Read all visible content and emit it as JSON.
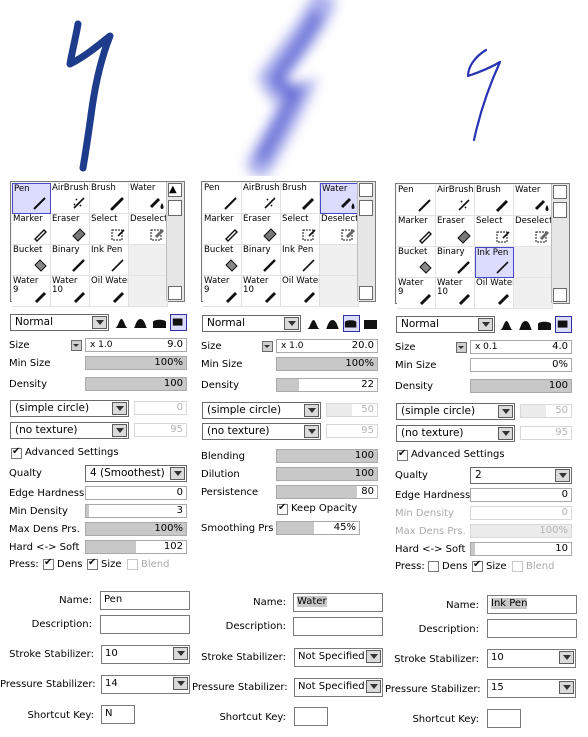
{
  "columns": [
    {
      "tools": [
        "Pen",
        "AirBrush",
        "Brush",
        "Water",
        "Marker",
        "Eraser",
        "Select",
        "Deselect",
        "Bucket",
        "Binary",
        "Ink Pen",
        "",
        "Water 9",
        "Water 10",
        "Oil Water",
        ""
      ],
      "selected_tool": 0,
      "blend_mode": "Normal",
      "selected_shape": 3,
      "size_prefix": "x 1.0",
      "size": "9.0",
      "min_size": "100%",
      "density": "100",
      "shape": "(simple circle)",
      "shape_value": "0",
      "texture": "(no texture)",
      "texture_value": "95",
      "advanced_label": "Advanced Settings",
      "rows": [
        {
          "label": "Qualty",
          "type": "select",
          "value": "4 (Smoothest)"
        },
        {
          "label": "Edge Hardness",
          "type": "bar",
          "value": "0",
          "fill": 0
        },
        {
          "label": "Min Density",
          "type": "bar",
          "value": "3",
          "fill": 3
        },
        {
          "label": "Max Dens Prs.",
          "type": "bar",
          "value": "100%",
          "fill": 100
        },
        {
          "label": "Hard <-> Soft",
          "type": "bar",
          "value": "102",
          "fill": 50
        }
      ],
      "press": {
        "label": "Press:",
        "dens": "Dens",
        "size": "Size",
        "blend": "Blend"
      },
      "form": {
        "name": "Pen",
        "description": "",
        "stroke_stabilizer": "10",
        "pressure_stabilizer": "14",
        "shortcut": "N"
      }
    },
    {
      "tools": [
        "Pen",
        "AirBrush",
        "Brush",
        "Water",
        "Marker",
        "Eraser",
        "Select",
        "Deselect",
        "Bucket",
        "Binary",
        "Ink Pen",
        "",
        "Water 9",
        "Water 10",
        "Oil Water",
        ""
      ],
      "selected_tool": 3,
      "blend_mode": "Normal",
      "selected_shape": 2,
      "size_prefix": "x 1.0",
      "size": "20.0",
      "min_size": "100%",
      "density": "22",
      "shape": "(simple circle)",
      "shape_value": "50",
      "texture": "(no texture)",
      "texture_value": "95",
      "rows": [
        {
          "label": "Blending",
          "type": "bar",
          "value": "100",
          "fill": 100
        },
        {
          "label": "Dilution",
          "type": "bar",
          "value": "100",
          "fill": 100
        },
        {
          "label": "Persistence",
          "type": "bar",
          "value": "80",
          "fill": 80
        },
        {
          "label": "",
          "type": "check",
          "value": "Keep Opacity"
        },
        {
          "label": "Smoothing Prs",
          "type": "bar",
          "value": "45%",
          "fill": 45
        }
      ],
      "form": {
        "name": "Water",
        "description": "",
        "stroke_stabilizer": "Not Specified",
        "pressure_stabilizer": "Not Specified",
        "shortcut": ""
      }
    },
    {
      "tools": [
        "Pen",
        "AirBrush",
        "Brush",
        "Water",
        "Marker",
        "Eraser",
        "Select",
        "Deselect",
        "Bucket",
        "Binary",
        "Ink Pen",
        "",
        "Water 9",
        "Water 10",
        "Oil Water",
        ""
      ],
      "selected_tool": 10,
      "blend_mode": "Normal",
      "selected_shape": 3,
      "size_prefix": "x 0.1",
      "size": "4.0",
      "min_size": "0%",
      "density": "100",
      "shape": "(simple circle)",
      "shape_value": "50",
      "texture": "(no texture)",
      "texture_value": "95",
      "advanced_label": "Advanced Settings",
      "rows": [
        {
          "label": "Qualty",
          "type": "select",
          "value": "2"
        },
        {
          "label": "Edge Hardness",
          "type": "bar",
          "value": "0",
          "fill": 0
        },
        {
          "label": "Min Density",
          "type": "bar",
          "value": "0",
          "fill": 0,
          "disabled": true
        },
        {
          "label": "Max Dens Prs.",
          "type": "bar",
          "value": "100%",
          "fill": 100,
          "disabled": true
        },
        {
          "label": "Hard <-> Soft",
          "type": "bar",
          "value": "10",
          "fill": 1
        }
      ],
      "press": {
        "label": "Press:",
        "dens": "Dens",
        "size": "Size",
        "blend": "Blend"
      },
      "form": {
        "name": "Ink Pen",
        "description": "",
        "stroke_stabilizer": "10",
        "pressure_stabilizer": "15",
        "shortcut": ""
      }
    }
  ],
  "labels": {
    "size": "Size",
    "min_size": "Min Size",
    "density": "Density",
    "name": "Name:",
    "description": "Description:",
    "stroke_stabilizer": "Stroke Stabilizer:",
    "pressure_stabilizer": "Pressure Stabilizer:",
    "shortcut": "Shortcut Key:"
  },
  "colors": {
    "stroke_pen": "#1e3c8c",
    "stroke_water": "#3c46c8",
    "stroke_inkpen": "#2834b4",
    "selected_cell": "#dcdcff",
    "bar_fill": "#c8c8c8"
  }
}
